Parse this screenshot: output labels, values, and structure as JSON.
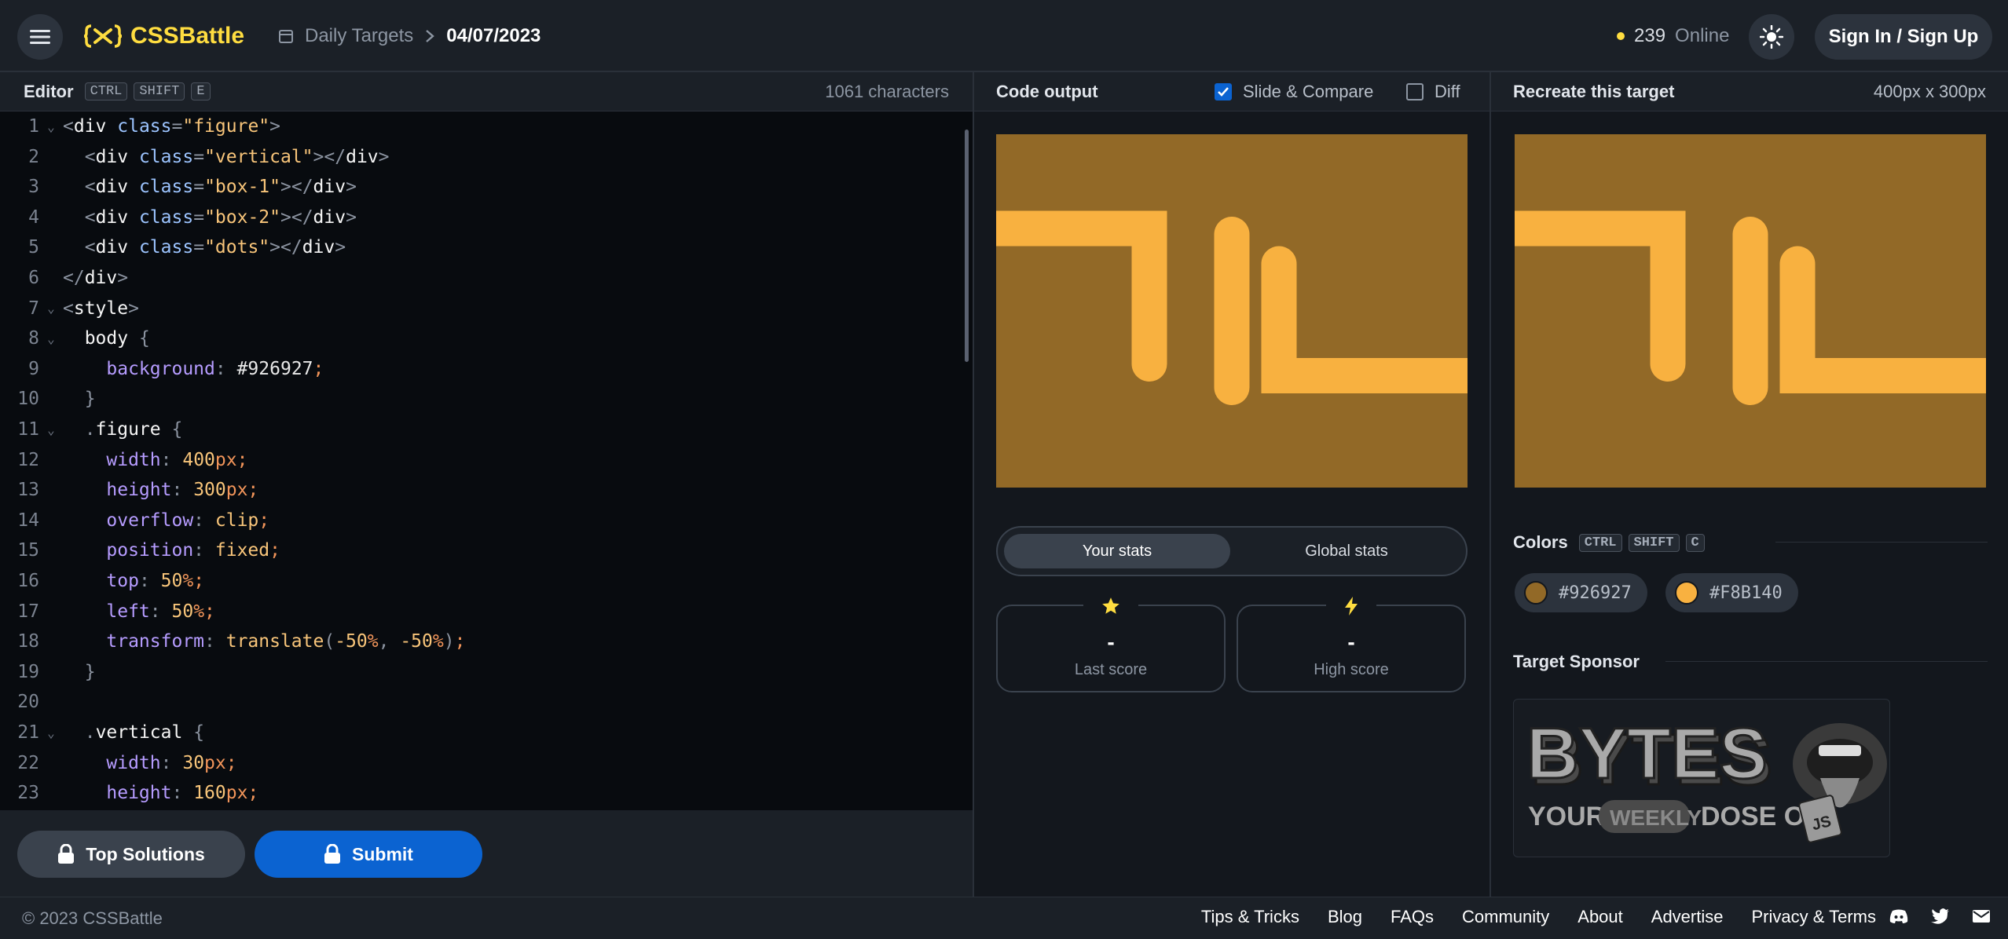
{
  "header": {
    "logo_text": "CSSBattle",
    "breadcrumb_section": "Daily Targets",
    "breadcrumb_current": "04/07/2023",
    "online_count": "239",
    "online_label": "Online",
    "signin_label": "Sign In / Sign Up"
  },
  "editor": {
    "title": "Editor",
    "shortcut": [
      "CTRL",
      "SHIFT",
      "E"
    ],
    "char_count": "1061 characters",
    "top_solutions_label": "Top Solutions",
    "submit_label": "Submit",
    "lines": [
      {
        "n": "1",
        "fold": true,
        "tokens": [
          [
            "t-punc",
            "<"
          ],
          [
            "t-tag",
            "div "
          ],
          [
            "t-attr",
            "class"
          ],
          [
            "t-punc",
            "="
          ],
          [
            "t-str",
            "\"figure\""
          ],
          [
            "t-punc",
            ">"
          ]
        ]
      },
      {
        "n": "2",
        "fold": false,
        "tokens": [
          [
            "code",
            "  "
          ],
          [
            "t-punc",
            "<"
          ],
          [
            "t-tag",
            "div "
          ],
          [
            "t-attr",
            "class"
          ],
          [
            "t-punc",
            "="
          ],
          [
            "t-str",
            "\"vertical\""
          ],
          [
            "t-punc",
            "></"
          ],
          [
            "t-tag",
            "div"
          ],
          [
            "t-punc",
            ">"
          ]
        ]
      },
      {
        "n": "3",
        "fold": false,
        "tokens": [
          [
            "code",
            "  "
          ],
          [
            "t-punc",
            "<"
          ],
          [
            "t-tag",
            "div "
          ],
          [
            "t-attr",
            "class"
          ],
          [
            "t-punc",
            "="
          ],
          [
            "t-str",
            "\"box-1\""
          ],
          [
            "t-punc",
            "></"
          ],
          [
            "t-tag",
            "div"
          ],
          [
            "t-punc",
            ">"
          ]
        ]
      },
      {
        "n": "4",
        "fold": false,
        "tokens": [
          [
            "code",
            "  "
          ],
          [
            "t-punc",
            "<"
          ],
          [
            "t-tag",
            "div "
          ],
          [
            "t-attr",
            "class"
          ],
          [
            "t-punc",
            "="
          ],
          [
            "t-str",
            "\"box-2\""
          ],
          [
            "t-punc",
            "></"
          ],
          [
            "t-tag",
            "div"
          ],
          [
            "t-punc",
            ">"
          ]
        ]
      },
      {
        "n": "5",
        "fold": false,
        "tokens": [
          [
            "code",
            "  "
          ],
          [
            "t-punc",
            "<"
          ],
          [
            "t-tag",
            "div "
          ],
          [
            "t-attr",
            "class"
          ],
          [
            "t-punc",
            "="
          ],
          [
            "t-str",
            "\"dots\""
          ],
          [
            "t-punc",
            "></"
          ],
          [
            "t-tag",
            "div"
          ],
          [
            "t-punc",
            ">"
          ]
        ]
      },
      {
        "n": "6",
        "fold": false,
        "tokens": [
          [
            "t-punc",
            "</"
          ],
          [
            "t-tag",
            "div"
          ],
          [
            "t-punc",
            ">"
          ]
        ]
      },
      {
        "n": "7",
        "fold": true,
        "tokens": [
          [
            "t-punc",
            "<"
          ],
          [
            "t-tag",
            "style"
          ],
          [
            "t-punc",
            ">"
          ]
        ]
      },
      {
        "n": "8",
        "fold": true,
        "tokens": [
          [
            "code",
            "  "
          ],
          [
            "t-sel",
            "body "
          ],
          [
            "t-punc",
            "{"
          ]
        ]
      },
      {
        "n": "9",
        "fold": false,
        "tokens": [
          [
            "code",
            "    "
          ],
          [
            "t-prop",
            "background"
          ],
          [
            "t-punc",
            ": "
          ],
          [
            "code",
            "#926927"
          ],
          [
            "t-unit",
            ";"
          ]
        ]
      },
      {
        "n": "10",
        "fold": false,
        "tokens": [
          [
            "code",
            "  "
          ],
          [
            "t-punc",
            "}"
          ]
        ]
      },
      {
        "n": "11",
        "fold": true,
        "tokens": [
          [
            "code",
            "  "
          ],
          [
            "t-punc",
            "."
          ],
          [
            "t-sel",
            "figure "
          ],
          [
            "t-punc",
            "{"
          ]
        ]
      },
      {
        "n": "12",
        "fold": false,
        "tokens": [
          [
            "code",
            "    "
          ],
          [
            "t-prop",
            "width"
          ],
          [
            "t-punc",
            ": "
          ],
          [
            "t-num",
            "400"
          ],
          [
            "t-unit",
            "px;"
          ]
        ]
      },
      {
        "n": "13",
        "fold": false,
        "tokens": [
          [
            "code",
            "    "
          ],
          [
            "t-prop",
            "height"
          ],
          [
            "t-punc",
            ": "
          ],
          [
            "t-num",
            "300"
          ],
          [
            "t-unit",
            "px;"
          ]
        ]
      },
      {
        "n": "14",
        "fold": false,
        "tokens": [
          [
            "code",
            "    "
          ],
          [
            "t-prop",
            "overflow"
          ],
          [
            "t-punc",
            ": "
          ],
          [
            "t-str",
            "clip"
          ],
          [
            "t-unit",
            ";"
          ]
        ]
      },
      {
        "n": "15",
        "fold": false,
        "tokens": [
          [
            "code",
            "    "
          ],
          [
            "t-prop",
            "position"
          ],
          [
            "t-punc",
            ": "
          ],
          [
            "t-str",
            "fixed"
          ],
          [
            "t-unit",
            ";"
          ]
        ]
      },
      {
        "n": "16",
        "fold": false,
        "tokens": [
          [
            "code",
            "    "
          ],
          [
            "t-prop",
            "top"
          ],
          [
            "t-punc",
            ": "
          ],
          [
            "t-num",
            "50"
          ],
          [
            "t-unit",
            "%;"
          ]
        ]
      },
      {
        "n": "17",
        "fold": false,
        "tokens": [
          [
            "code",
            "    "
          ],
          [
            "t-prop",
            "left"
          ],
          [
            "t-punc",
            ": "
          ],
          [
            "t-num",
            "50"
          ],
          [
            "t-unit",
            "%;"
          ]
        ]
      },
      {
        "n": "18",
        "fold": false,
        "tokens": [
          [
            "code",
            "    "
          ],
          [
            "t-prop",
            "transform"
          ],
          [
            "t-punc",
            ": "
          ],
          [
            "t-fn",
            "translate"
          ],
          [
            "t-punc",
            "("
          ],
          [
            "t-num",
            "-50"
          ],
          [
            "t-unit",
            "%"
          ],
          [
            "t-punc",
            ", "
          ],
          [
            "t-num",
            "-50"
          ],
          [
            "t-unit",
            "%"
          ],
          [
            "t-punc",
            ")"
          ],
          [
            "t-unit",
            ";"
          ]
        ]
      },
      {
        "n": "19",
        "fold": false,
        "tokens": [
          [
            "code",
            "  "
          ],
          [
            "t-punc",
            "}"
          ]
        ]
      },
      {
        "n": "20",
        "fold": false,
        "tokens": []
      },
      {
        "n": "21",
        "fold": true,
        "tokens": [
          [
            "code",
            "  "
          ],
          [
            "t-punc",
            "."
          ],
          [
            "t-sel",
            "vertical "
          ],
          [
            "t-punc",
            "{"
          ]
        ]
      },
      {
        "n": "22",
        "fold": false,
        "tokens": [
          [
            "code",
            "    "
          ],
          [
            "t-prop",
            "width"
          ],
          [
            "t-punc",
            ": "
          ],
          [
            "t-num",
            "30"
          ],
          [
            "t-unit",
            "px;"
          ]
        ]
      },
      {
        "n": "23",
        "fold": false,
        "tokens": [
          [
            "code",
            "    "
          ],
          [
            "t-prop",
            "height"
          ],
          [
            "t-punc",
            ": "
          ],
          [
            "t-num",
            "160"
          ],
          [
            "t-unit",
            "px;"
          ]
        ]
      }
    ]
  },
  "output": {
    "title": "Code output",
    "slide_compare_label": "Slide & Compare",
    "slide_compare_checked": true,
    "diff_label": "Diff",
    "diff_checked": false,
    "tab_your_stats": "Your stats",
    "tab_global_stats": "Global stats",
    "last_score_value": "-",
    "last_score_label": "Last score",
    "high_score_value": "-",
    "high_score_label": "High score"
  },
  "target": {
    "title": "Recreate this target",
    "size": "400px x 300px",
    "colors_title": "Colors",
    "colors_shortcut": [
      "CTRL",
      "SHIFT",
      "C"
    ],
    "colors": [
      {
        "hex": "#926927",
        "label": "#926927"
      },
      {
        "hex": "#F8B140",
        "label": "#F8B140"
      }
    ],
    "sponsor_title": "Target Sponsor",
    "sponsor_logo_text": "BYTES",
    "sponsor_tagline_1": "YOUR",
    "sponsor_tagline_2": "WEEKLY",
    "sponsor_tagline_3": "DOSE OF",
    "sponsor_badge": "JS"
  },
  "art_colors": {
    "background": "#926927",
    "shape": "#F8B140"
  },
  "footer": {
    "copyright": "© 2023 CSSBattle",
    "links": [
      "Tips & Tricks",
      "Blog",
      "FAQs",
      "Community",
      "About",
      "Advertise",
      "Privacy & Terms"
    ]
  },
  "icons": {
    "menu": "hamburger-icon",
    "logo": "cssbattle-logo-icon",
    "calendar": "calendar-icon",
    "chevron": "chevron-right-icon",
    "theme": "sun-icon",
    "lock": "lock-icon",
    "star": "star-icon",
    "bolt": "bolt-icon",
    "discord": "discord-icon",
    "twitter": "twitter-icon",
    "mail": "mail-icon"
  }
}
